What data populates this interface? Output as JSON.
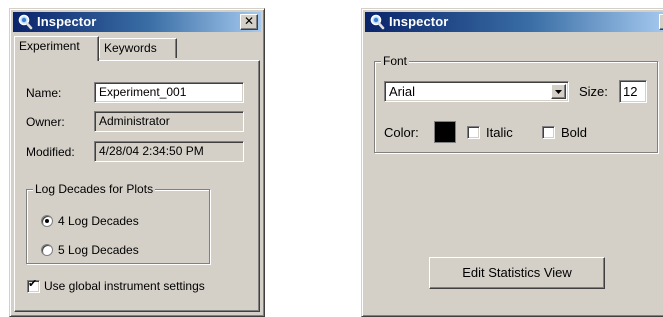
{
  "left_window": {
    "title": "Inspector",
    "close_glyph": "✕",
    "tabs": [
      {
        "label": "Experiment",
        "active": true
      },
      {
        "label": "Keywords",
        "active": false
      }
    ],
    "fields": {
      "name_label": "Name:",
      "name_value": "Experiment_001",
      "owner_label": "Owner:",
      "owner_value": "Administrator",
      "modified_label": "Modified:",
      "modified_value": "4/28/04 2:34:50 PM"
    },
    "log_group": {
      "title": "Log Decades for Plots",
      "options": [
        {
          "label": "4 Log Decades",
          "selected": true
        },
        {
          "label": "5 Log Decades",
          "selected": false
        }
      ]
    },
    "global_settings": {
      "label": "Use global instrument settings",
      "checked": true,
      "check_glyph": "✔"
    }
  },
  "right_window": {
    "title": "Inspector",
    "close_glyph": "✕",
    "font_group": {
      "title": "Font",
      "font_value": "Arial",
      "size_label": "Size:",
      "size_value": "12",
      "color_label": "Color:",
      "color_value": "#000000",
      "italic_label": "Italic",
      "italic_checked": false,
      "bold_label": "Bold",
      "bold_checked": false
    },
    "edit_button_label": "Edit Statistics View"
  },
  "colors": {
    "face": "#d4d0c8",
    "titlebar_start": "#0a246a",
    "titlebar_end": "#a6caf0"
  }
}
